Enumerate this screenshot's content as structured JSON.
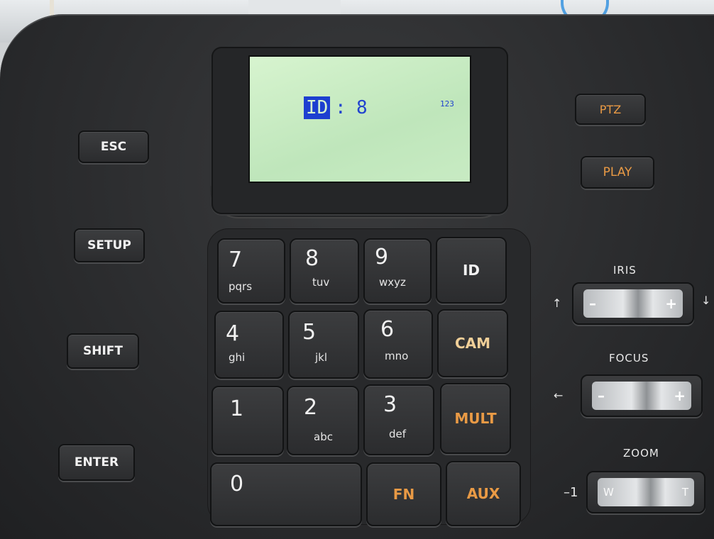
{
  "lcd": {
    "field_label": "ID",
    "colon": ":",
    "value": "8",
    "input_mode": "123"
  },
  "left_keys": [
    "ESC",
    "SETUP",
    "SHIFT",
    "ENTER"
  ],
  "top_right_keys": [
    "PTZ",
    "PLAY"
  ],
  "keypad": [
    {
      "num": "7",
      "sub": "pqrs"
    },
    {
      "num": "8",
      "sub": "tuv"
    },
    {
      "num": "9",
      "sub": "wxyz"
    },
    {
      "num": "4",
      "sub": "ghi"
    },
    {
      "num": "5",
      "sub": "jkl"
    },
    {
      "num": "6",
      "sub": "mno"
    },
    {
      "num": "1",
      "sub": ""
    },
    {
      "num": "2",
      "sub": "abc"
    },
    {
      "num": "3",
      "sub": "def"
    },
    {
      "num": "0",
      "sub": ""
    }
  ],
  "function_keys": [
    "ID",
    "CAM",
    "MULT",
    "FN",
    "AUX"
  ],
  "controls": {
    "iris": {
      "label": "IRIS",
      "minus": "–",
      "plus": "+",
      "left_glyph": "↑",
      "right_glyph": "↓"
    },
    "focus": {
      "label": "FOCUS",
      "minus": "–",
      "plus": "+",
      "left_glyph": "←",
      "right_glyph": "→"
    },
    "zoom": {
      "label": "ZOOM",
      "minus": "W",
      "plus": "T",
      "left_glyph": "–1"
    }
  },
  "colors": {
    "lcd_background": "#c9ecc3",
    "lcd_text": "#2143cf",
    "orange_label": "#e99a45",
    "body": "#2b2c2e"
  }
}
